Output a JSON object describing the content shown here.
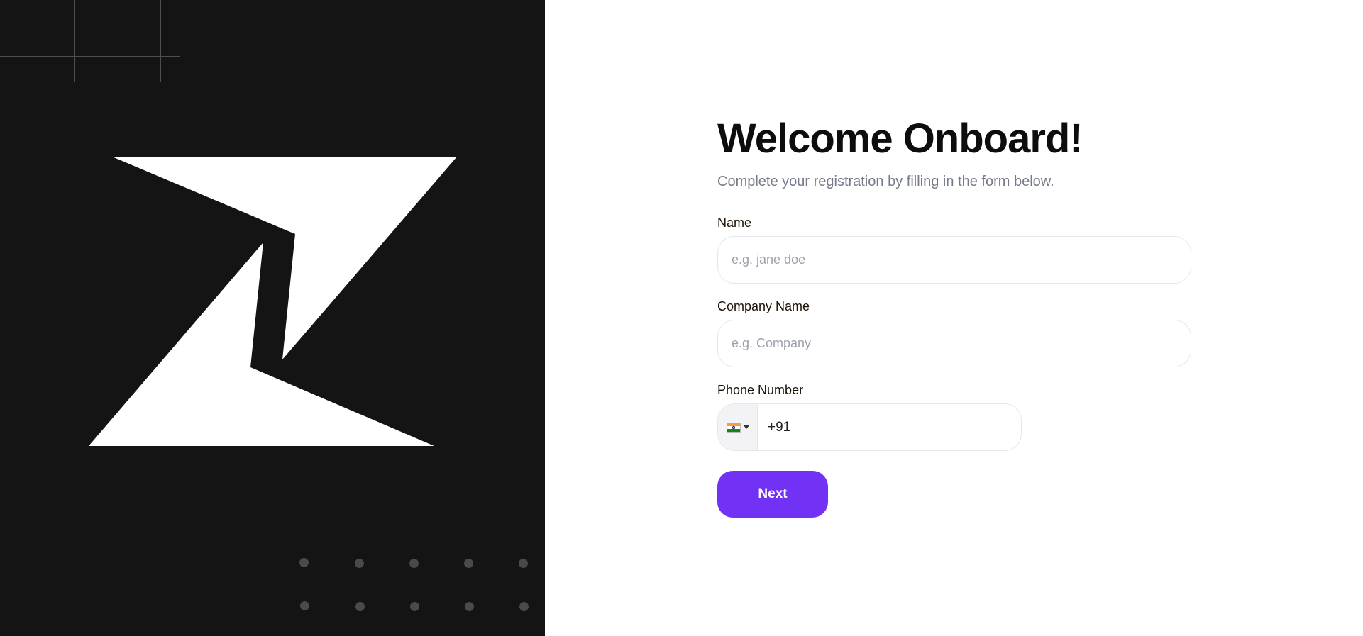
{
  "brand": {
    "logo_icon": "z-lightning-logo-icon",
    "panel_color": "#141414",
    "logo_color": "#ffffff",
    "dot_color": "#4a4a4e"
  },
  "form": {
    "title": "Welcome Onboard!",
    "subtitle": "Complete your registration by filling in the form below.",
    "name": {
      "label": "Name",
      "placeholder": "e.g. jane doe",
      "value": ""
    },
    "company": {
      "label": "Company Name",
      "placeholder": "e.g. Company",
      "value": ""
    },
    "phone": {
      "label": "Phone Number",
      "country_flag_icon": "india-flag-icon",
      "dial_code": "+91",
      "value": "+91"
    },
    "next_label": "Next",
    "accent_color": "#7132f5"
  }
}
